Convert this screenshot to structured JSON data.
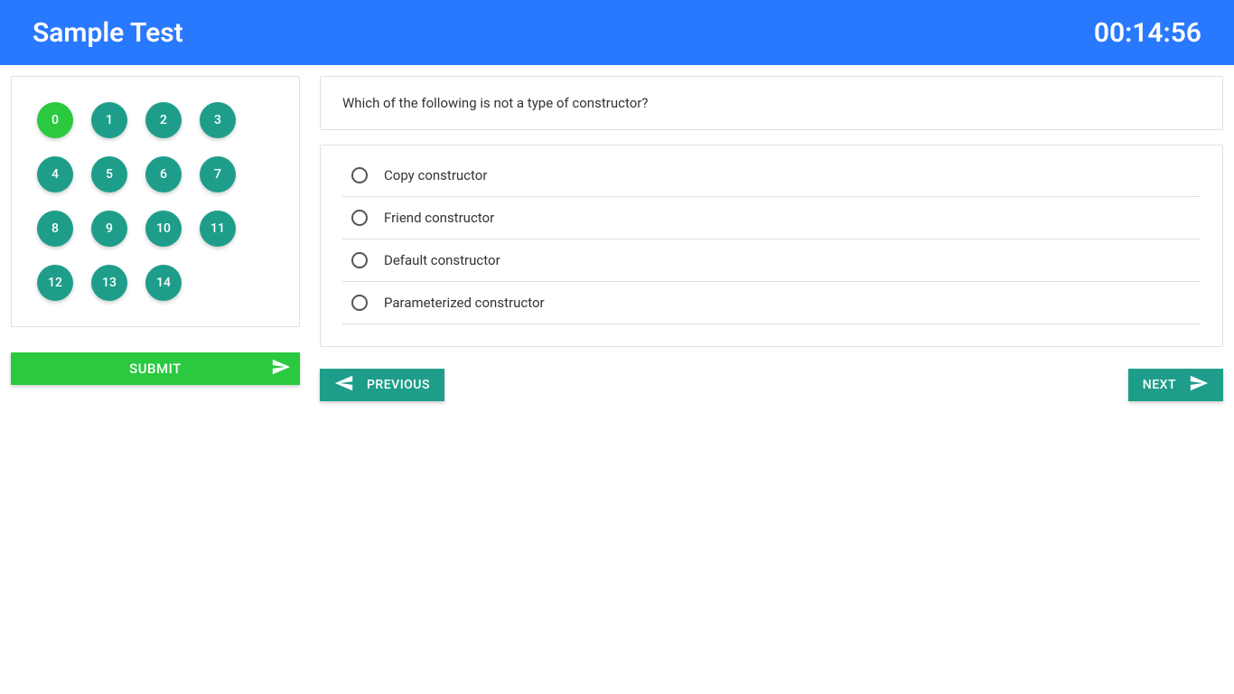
{
  "header": {
    "title": "Sample Test",
    "timer": "00:14:56"
  },
  "sidebar": {
    "questions": [
      {
        "num": "0",
        "active": true
      },
      {
        "num": "1",
        "active": false
      },
      {
        "num": "2",
        "active": false
      },
      {
        "num": "3",
        "active": false
      },
      {
        "num": "4",
        "active": false
      },
      {
        "num": "5",
        "active": false
      },
      {
        "num": "6",
        "active": false
      },
      {
        "num": "7",
        "active": false
      },
      {
        "num": "8",
        "active": false
      },
      {
        "num": "9",
        "active": false
      },
      {
        "num": "10",
        "active": false
      },
      {
        "num": "11",
        "active": false
      },
      {
        "num": "12",
        "active": false
      },
      {
        "num": "13",
        "active": false
      },
      {
        "num": "14",
        "active": false
      }
    ],
    "submit_label": "SUBMIT"
  },
  "question": {
    "text": "Which of the following is not a type of constructor?",
    "options": [
      "Copy constructor",
      "Friend constructor",
      "Default constructor",
      "Parameterized constructor"
    ]
  },
  "nav": {
    "previous_label": "PREVIOUS",
    "next_label": "NEXT"
  }
}
